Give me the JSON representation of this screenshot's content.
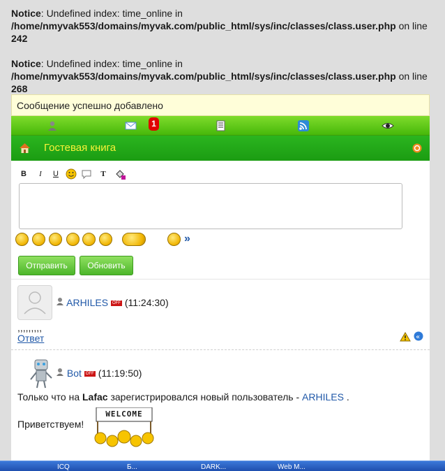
{
  "notices": [
    {
      "label": "Notice",
      "text_a": ": Undefined index: time_online in",
      "path": "/home/nmyvak553/domains/myvak.com/public_html/sys/inc/classes/class.user.php",
      "text_b": " on line ",
      "line": "242"
    },
    {
      "label": "Notice",
      "text_a": ": Undefined index: time_online in",
      "path": "/home/nmyvak553/domains/myvak.com/public_html/sys/inc/classes/class.user.php",
      "text_b": " on line ",
      "line": "268"
    }
  ],
  "message": "Сообщение успешно добавлено",
  "nav": {
    "mail_badge": "1"
  },
  "title": "Гостевая книга",
  "buttons": {
    "send": "Отправить",
    "refresh": "Обновить"
  },
  "more_smileys": "»",
  "toolbar": {
    "bold": "B",
    "italic": "I",
    "underline": "U",
    "text_color": "T"
  },
  "posts": [
    {
      "user": "ARHILES",
      "time": "(11:24:30)",
      "status": "OFF",
      "text": ",,,,,,,,,",
      "reply": "Ответ"
    },
    {
      "user": "Bot",
      "time": "(11:19:50)",
      "status": "OFF",
      "text_before": "Только что на ",
      "site": "Lafac",
      "text_middle": " зарегистрировался новый пользователь - ",
      "new_user": "ARHILES",
      "text_after": " .",
      "greeting": "Приветствуем!",
      "banner": "WELCOME"
    }
  ],
  "taskbar": [
    "ICQ",
    "Б...",
    "DARK...",
    "Web M..."
  ],
  "colors": {
    "nav_green": "#5cc41a",
    "title_green": "#22a818",
    "title_text": "#f8f238",
    "link": "#2058a8",
    "alert_bg": "#fffed9"
  }
}
